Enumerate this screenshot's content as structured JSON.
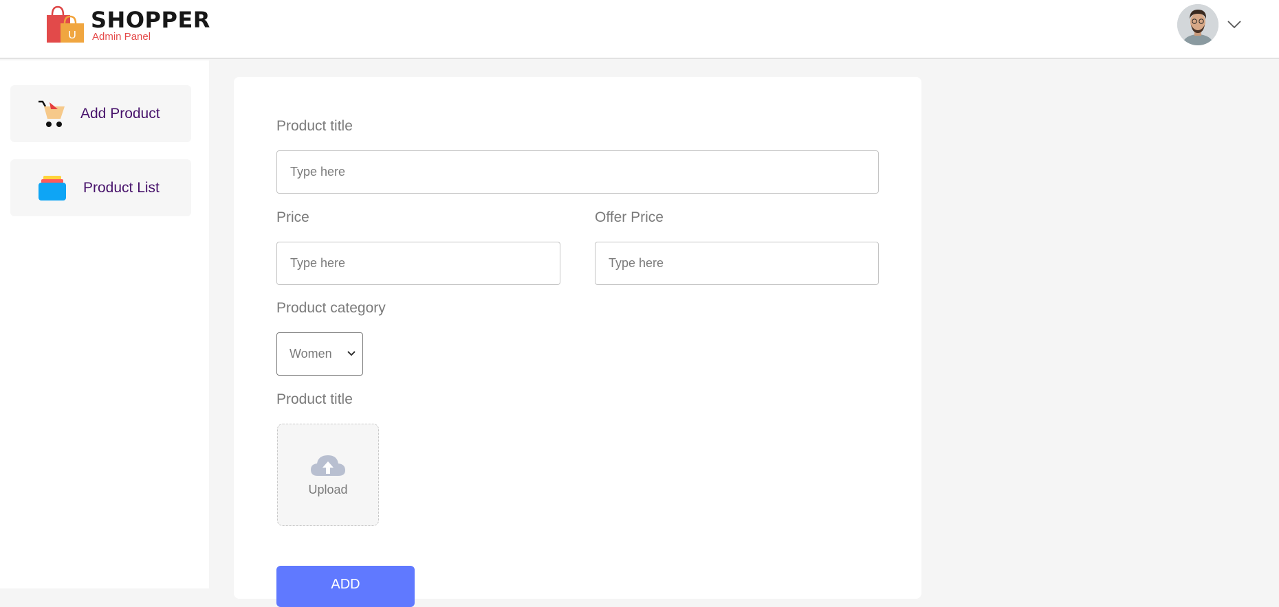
{
  "navbar": {
    "brand_name": "SHOPPER",
    "brand_subtitle": "Admin Panel",
    "logo_letter": "U"
  },
  "sidebar": {
    "items": [
      {
        "label": "Add Product",
        "icon": "cart-icon"
      },
      {
        "label": "Product List",
        "icon": "product-list-icon"
      }
    ]
  },
  "form": {
    "title_label": "Product title",
    "title_placeholder": "Type here",
    "price_label": "Price",
    "price_placeholder": "Type here",
    "offer_label": "Offer Price",
    "offer_placeholder": "Type here",
    "category_label": "Product category",
    "category_value": "Women",
    "image_label": "Product title",
    "upload_label": "Upload",
    "add_button": "ADD"
  },
  "colors": {
    "brand_red": "#e54848",
    "sidebar_text": "#47126b",
    "button_blue": "#6079ff"
  }
}
